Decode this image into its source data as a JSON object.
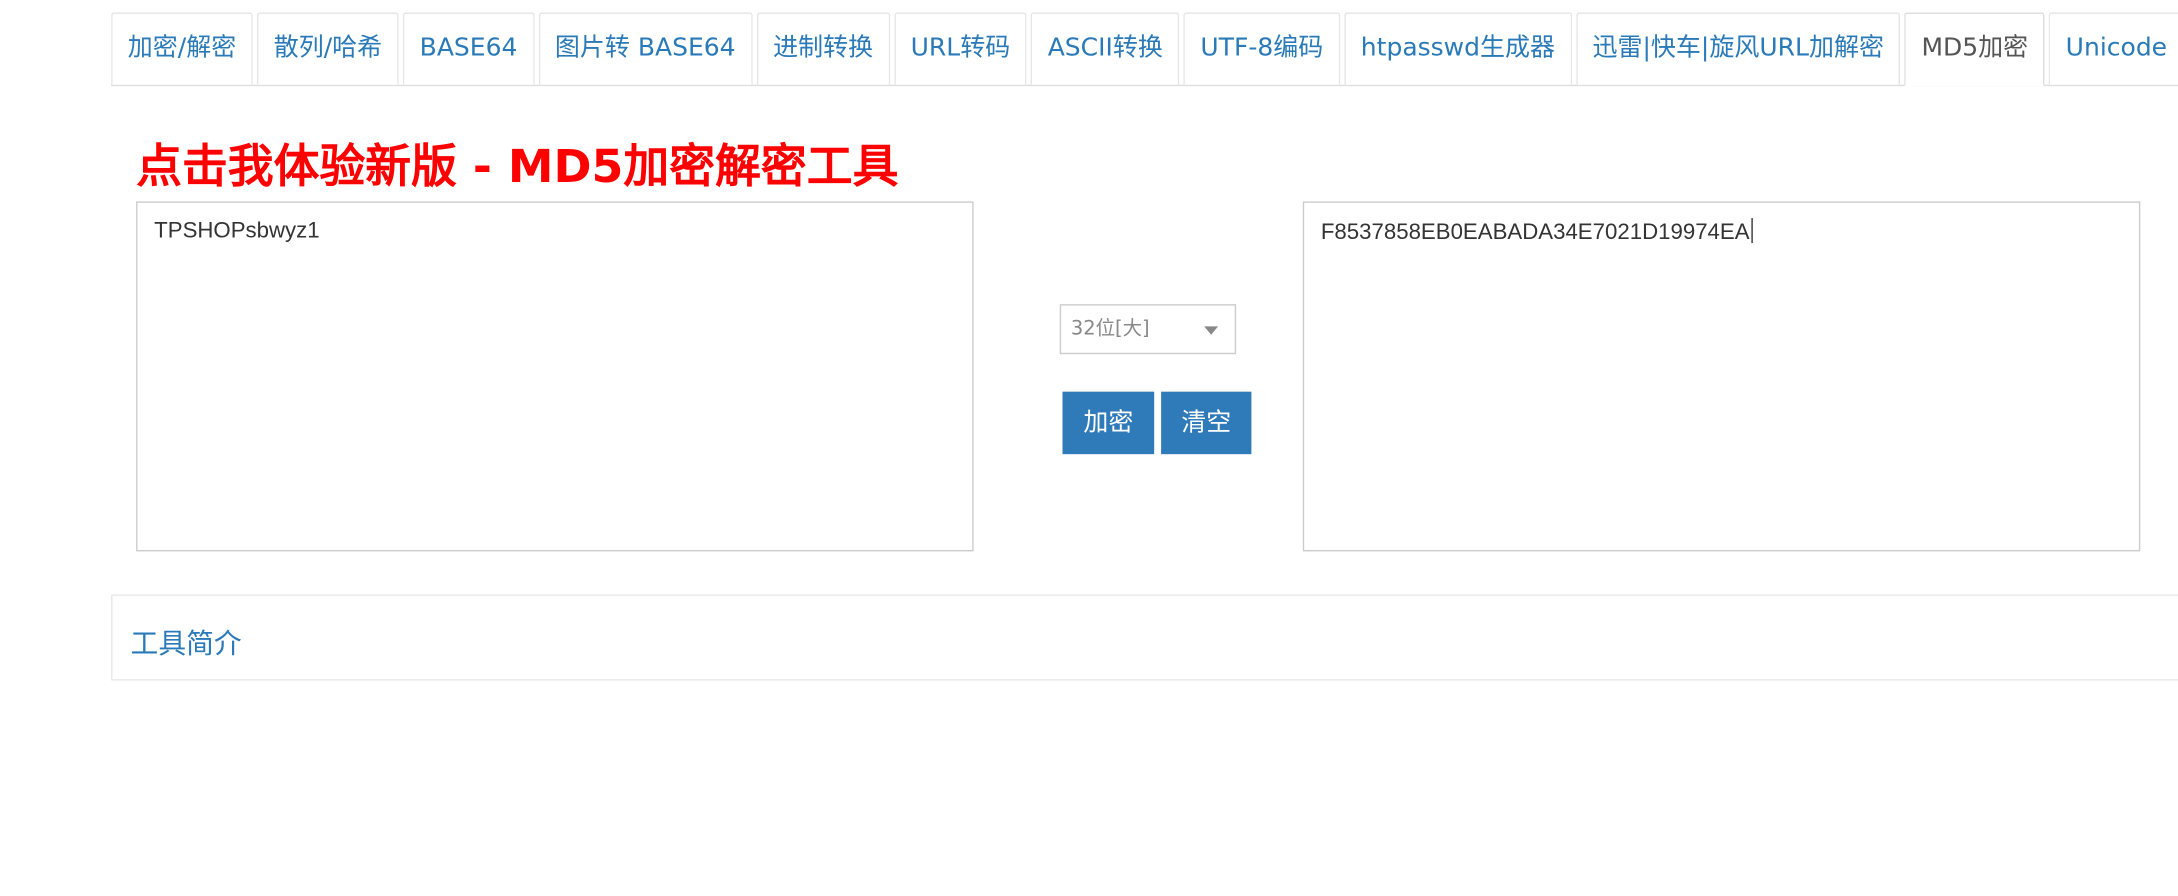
{
  "tabs": [
    {
      "label": "加密/解密",
      "active": false
    },
    {
      "label": "散列/哈希",
      "active": false
    },
    {
      "label": "BASE64",
      "active": false
    },
    {
      "label": "图片转 BASE64",
      "active": false
    },
    {
      "label": "进制转换",
      "active": false
    },
    {
      "label": "URL转码",
      "active": false
    },
    {
      "label": "ASCII转换",
      "active": false
    },
    {
      "label": "UTF-8编码",
      "active": false
    },
    {
      "label": "htpasswd生成器",
      "active": false
    },
    {
      "label": "迅雷|快车|旋风URL加解密",
      "active": false
    },
    {
      "label": "MD5加密",
      "active": true
    },
    {
      "label": "Unicode",
      "active": false
    }
  ],
  "promo": {
    "text": "点击我体验新版 - MD5加密解密工具"
  },
  "input": {
    "value": "TPSHOPsbwyz1"
  },
  "output": {
    "value": "F8537858EB0EABADA34E7021D19974EA"
  },
  "mode_select": {
    "selected": "32位[大]"
  },
  "buttons": {
    "encrypt": "加密",
    "clear": "清空"
  },
  "intro": {
    "title": "工具简介"
  },
  "colors": {
    "accent": "#2f7ab8",
    "link": "#2a7ab8",
    "promo": "#ff0000",
    "border": "#cccccc"
  }
}
